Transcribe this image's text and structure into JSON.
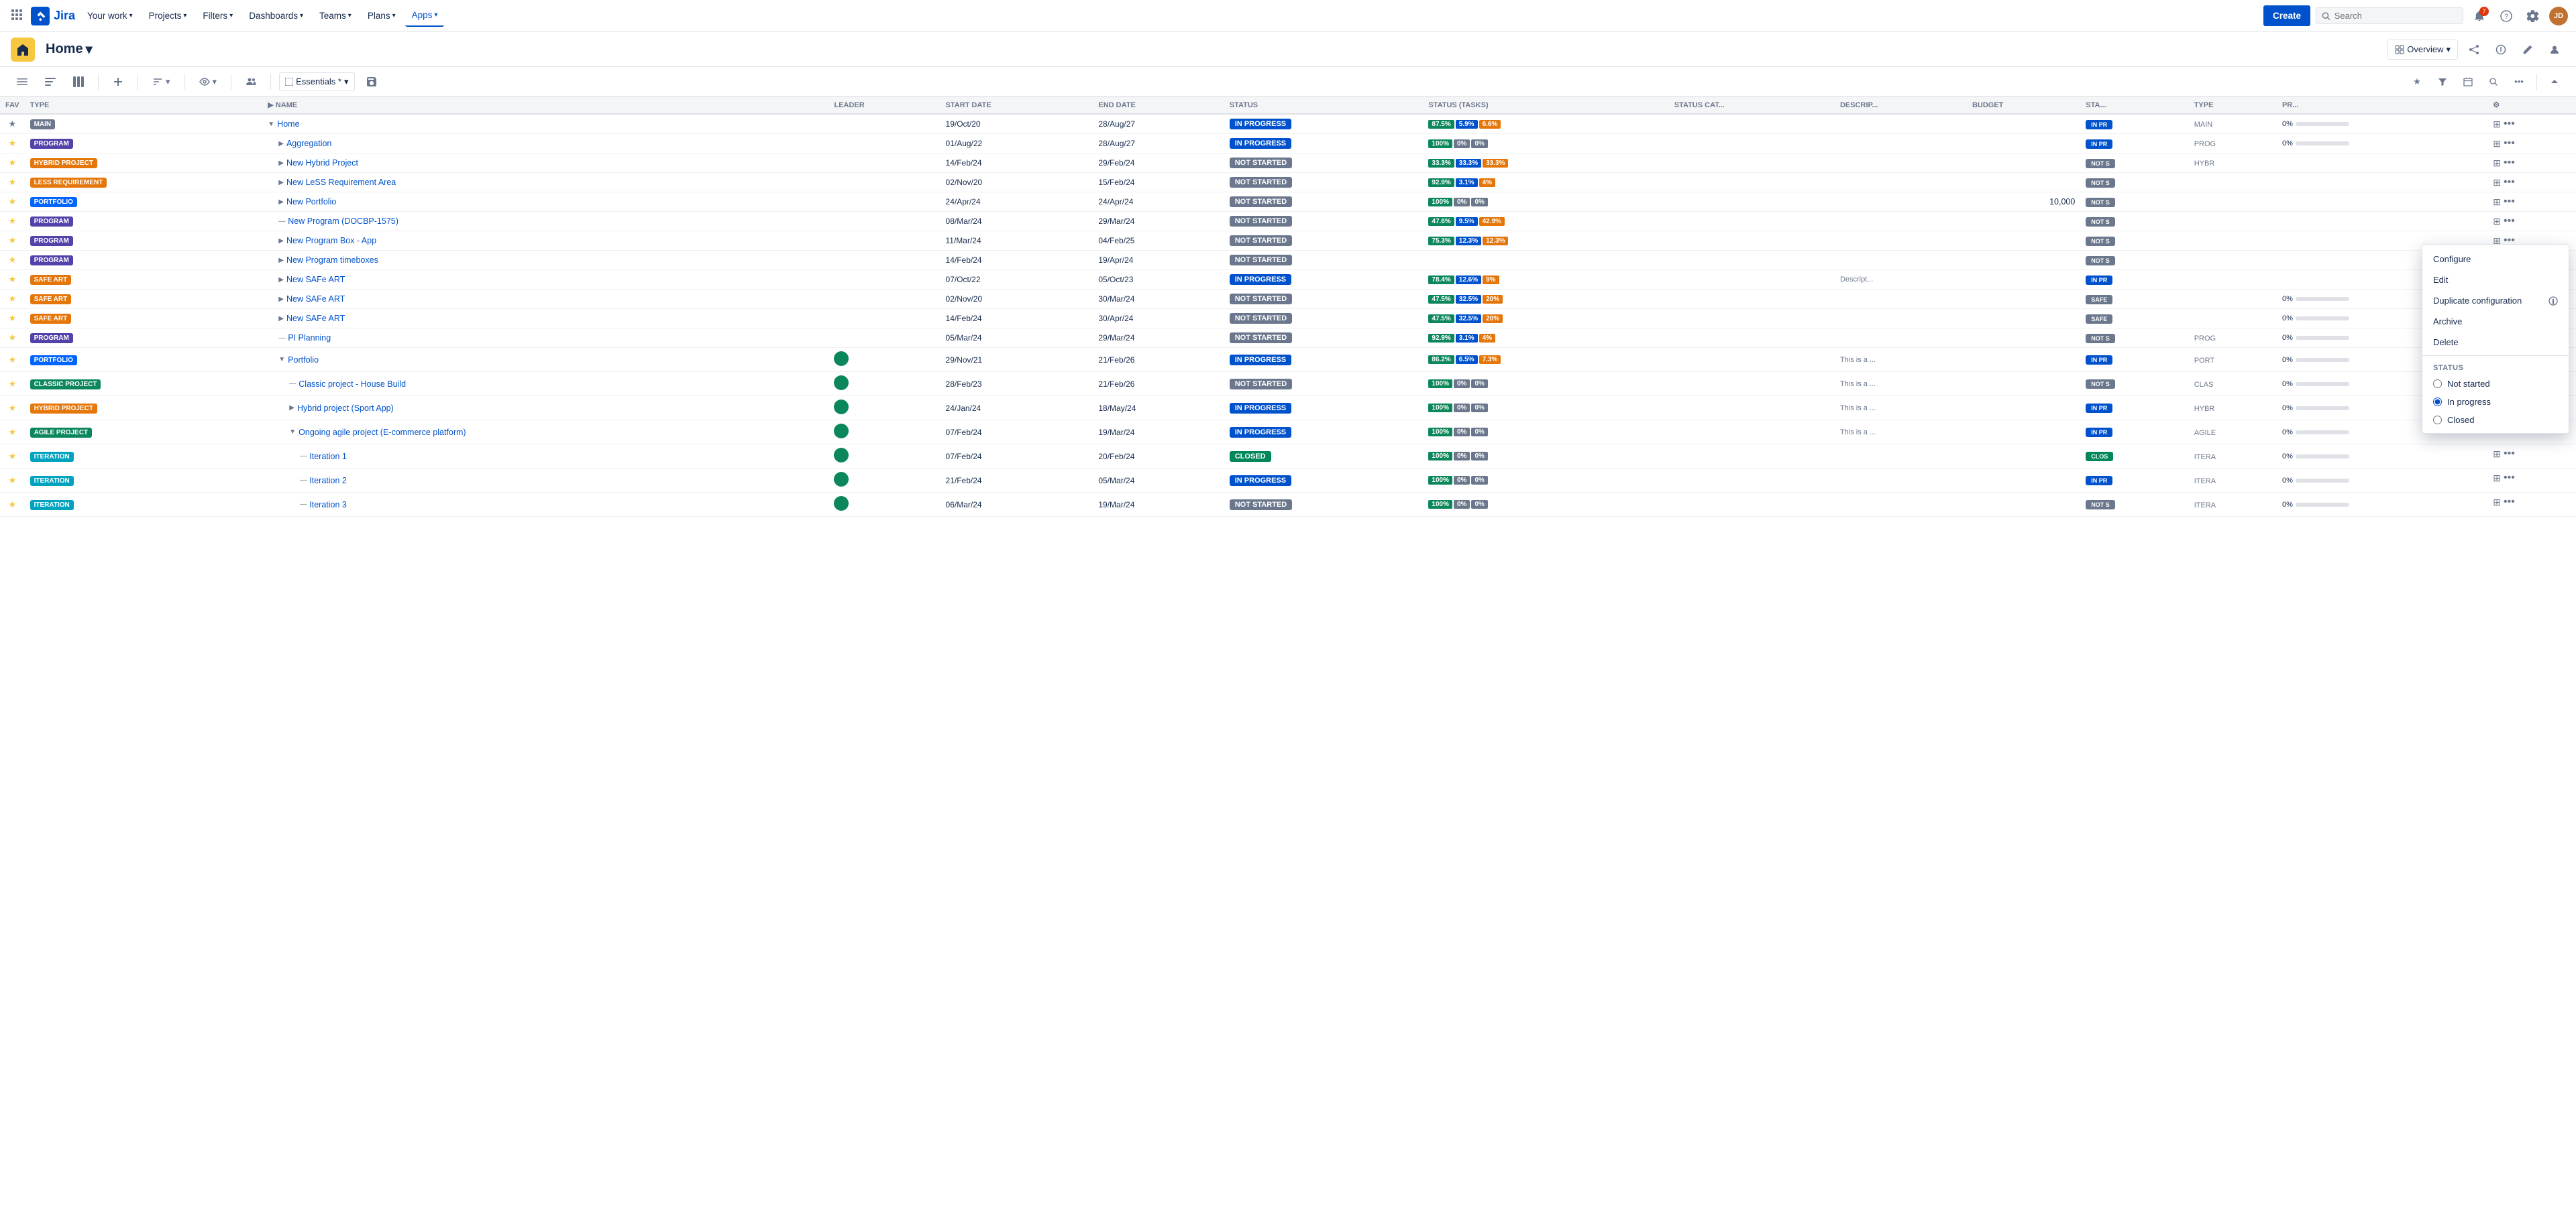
{
  "nav": {
    "logo_text": "Jira",
    "links": [
      {
        "label": "Your work",
        "caret": true
      },
      {
        "label": "Projects",
        "caret": true
      },
      {
        "label": "Filters",
        "caret": true
      },
      {
        "label": "Dashboards",
        "caret": true
      },
      {
        "label": "Teams",
        "caret": true
      },
      {
        "label": "Plans",
        "caret": true
      },
      {
        "label": "Apps",
        "caret": true,
        "active": true
      }
    ],
    "create_label": "Create",
    "search_placeholder": "Search",
    "notification_count": "7"
  },
  "second_nav": {
    "title": "Home",
    "overview_label": "Overview"
  },
  "toolbar": {
    "essentials_label": "Essentials *"
  },
  "table": {
    "headers": [
      "FAV",
      "TYPE",
      "NAME",
      "LEADER",
      "START DATE",
      "END DATE",
      "STATUS",
      "STATUS (TASKS)",
      "STATUS CAT...",
      "DESCRIP...",
      "BUDGET",
      "STA...",
      "TYPE",
      "PR..."
    ],
    "rows": [
      {
        "fav": false,
        "type": "MAIN",
        "type_class": "type-main",
        "name": "Home",
        "indent": 0,
        "expand": "collapse",
        "leader": "",
        "start": "19/Oct/20",
        "end": "28/Aug/27",
        "status": "IN PROGRESS",
        "status_class": "status-in-progress",
        "prog1": "87.5%",
        "prog1_class": "prog-green",
        "prog2": "5.9%",
        "prog2_class": "prog-blue",
        "prog3": "6.6%",
        "prog3_class": "prog-orange",
        "desc": "",
        "budget": "",
        "sta": "IN PR",
        "type2": "MAIN",
        "pr": "0%"
      },
      {
        "fav": true,
        "type": "PROGRAM",
        "type_class": "type-program",
        "name": "Aggregation",
        "indent": 1,
        "expand": "expand",
        "leader": "",
        "start": "01/Aug/22",
        "end": "28/Aug/27",
        "status": "IN PROGRESS",
        "status_class": "status-in-progress",
        "prog1": "100%",
        "prog1_class": "prog-green",
        "prog2": "0%",
        "prog2_class": "prog-gray",
        "prog3": "0%",
        "prog3_class": "prog-gray",
        "desc": "",
        "budget": "",
        "sta": "IN PR",
        "type2": "PROG",
        "pr": "0%"
      },
      {
        "fav": true,
        "type": "HYBRID PROJECT",
        "type_class": "type-hybrid",
        "name": "New Hybrid Project",
        "indent": 1,
        "expand": "expand",
        "leader": "",
        "start": "14/Feb/24",
        "end": "29/Feb/24",
        "status": "NOT STARTED",
        "status_class": "status-not-started",
        "prog1": "33.3%",
        "prog1_class": "prog-green",
        "prog2": "33.3%",
        "prog2_class": "prog-blue",
        "prog3": "33.3%",
        "prog3_class": "prog-orange",
        "desc": "",
        "budget": "",
        "sta": "NOT S",
        "type2": "HYBR",
        "pr": ""
      },
      {
        "fav": true,
        "type": "LESS REQUIREMENT",
        "type_class": "type-less",
        "name": "New LeSS Requirement Area",
        "indent": 1,
        "expand": "expand",
        "leader": "",
        "start": "02/Nov/20",
        "end": "15/Feb/24",
        "status": "NOT STARTED",
        "status_class": "status-not-started",
        "prog1": "92.9%",
        "prog1_class": "prog-green",
        "prog2": "3.1%",
        "prog2_class": "prog-blue",
        "prog3": "4%",
        "prog3_class": "prog-orange",
        "desc": "",
        "budget": "",
        "sta": "NOT S",
        "type2": "",
        "pr": ""
      },
      {
        "fav": true,
        "type": "PORTFOLIO",
        "type_class": "type-portfolio",
        "name": "New Portfolio",
        "indent": 1,
        "expand": "expand",
        "leader": "",
        "start": "24/Apr/24",
        "end": "24/Apr/24",
        "status": "NOT STARTED",
        "status_class": "status-not-started",
        "prog1": "100%",
        "prog1_class": "prog-green",
        "prog2": "0%",
        "prog2_class": "prog-gray",
        "prog3": "0%",
        "prog3_class": "prog-gray",
        "desc": "",
        "budget": "10,000",
        "sta": "NOT S",
        "type2": "",
        "pr": ""
      },
      {
        "fav": true,
        "type": "PROGRAM",
        "type_class": "type-program",
        "name": "New Program (DOCBP-1575)",
        "indent": 1,
        "expand": "dash",
        "leader": "",
        "start": "08/Mar/24",
        "end": "29/Mar/24",
        "status": "NOT STARTED",
        "status_class": "status-not-started",
        "prog1": "47.6%",
        "prog1_class": "prog-green",
        "prog2": "9.5%",
        "prog2_class": "prog-blue",
        "prog3": "42.9%",
        "prog3_class": "prog-orange",
        "desc": "",
        "budget": "",
        "sta": "NOT S",
        "type2": "",
        "pr": ""
      },
      {
        "fav": true,
        "type": "PROGRAM",
        "type_class": "type-program",
        "name": "New Program Box - App",
        "indent": 1,
        "expand": "expand",
        "leader": "",
        "start": "11/Mar/24",
        "end": "04/Feb/25",
        "status": "NOT STARTED",
        "status_class": "status-not-started",
        "prog1": "75.3%",
        "prog1_class": "prog-green",
        "prog2": "12.3%",
        "prog2_class": "prog-blue",
        "prog3": "12.3%",
        "prog3_class": "prog-orange",
        "desc": "",
        "budget": "",
        "sta": "NOT S",
        "type2": "",
        "pr": ""
      },
      {
        "fav": true,
        "type": "PROGRAM",
        "type_class": "type-program",
        "name": "New Program timeboxes",
        "indent": 1,
        "expand": "expand",
        "leader": "",
        "start": "14/Feb/24",
        "end": "19/Apr/24",
        "status": "NOT STARTED",
        "status_class": "status-not-started",
        "prog1": "",
        "prog1_class": "",
        "prog2": "",
        "prog2_class": "",
        "prog3": "",
        "prog3_class": "",
        "desc": "",
        "budget": "",
        "sta": "NOT S",
        "type2": "",
        "pr": ""
      },
      {
        "fav": true,
        "type": "SAFE ART",
        "type_class": "type-safe",
        "name": "New SAFe ART",
        "indent": 1,
        "expand": "expand",
        "leader": "",
        "start": "07/Oct/22",
        "end": "05/Oct/23",
        "status": "IN PROGRESS",
        "status_class": "status-in-progress",
        "prog1": "78.4%",
        "prog1_class": "prog-green",
        "prog2": "12.6%",
        "prog2_class": "prog-blue",
        "prog3": "9%",
        "prog3_class": "prog-orange",
        "desc": "Descript...",
        "budget": "",
        "sta": "IN PR",
        "type2": "",
        "pr": ""
      },
      {
        "fav": true,
        "type": "SAFE ART",
        "type_class": "type-safe",
        "name": "New SAFe ART",
        "indent": 1,
        "expand": "expand",
        "leader": "",
        "start": "02/Nov/20",
        "end": "30/Mar/24",
        "status": "NOT STARTED",
        "status_class": "status-not-started",
        "prog1": "47.5%",
        "prog1_class": "prog-green",
        "prog2": "32.5%",
        "prog2_class": "prog-blue",
        "prog3": "20%",
        "prog3_class": "prog-orange",
        "desc": "",
        "budget": "",
        "sta": "SAFE",
        "type2": "",
        "pr": "0%"
      },
      {
        "fav": true,
        "type": "SAFE ART",
        "type_class": "type-safe",
        "name": "New SAFe ART",
        "indent": 1,
        "expand": "expand",
        "leader": "",
        "start": "14/Feb/24",
        "end": "30/Apr/24",
        "status": "NOT STARTED",
        "status_class": "status-not-started",
        "prog1": "47.5%",
        "prog1_class": "prog-green",
        "prog2": "32.5%",
        "prog2_class": "prog-blue",
        "prog3": "20%",
        "prog3_class": "prog-orange",
        "desc": "",
        "budget": "",
        "sta": "SAFE",
        "type2": "",
        "pr": "0%"
      },
      {
        "fav": true,
        "type": "PROGRAM",
        "type_class": "type-program",
        "name": "PI Planning",
        "indent": 1,
        "expand": "dash",
        "leader": "",
        "start": "05/Mar/24",
        "end": "29/Mar/24",
        "status": "NOT STARTED",
        "status_class": "status-not-started",
        "prog1": "92.9%",
        "prog1_class": "prog-green",
        "prog2": "3.1%",
        "prog2_class": "prog-blue",
        "prog3": "4%",
        "prog3_class": "prog-orange",
        "desc": "",
        "budget": "",
        "sta": "NOT S",
        "type2": "PROG",
        "pr": "0%"
      },
      {
        "fav": true,
        "type": "PORTFOLIO",
        "type_class": "type-portfolio",
        "name": "Portfolio",
        "indent": 1,
        "expand": "collapse",
        "leader": "avatar",
        "start": "29/Nov/21",
        "end": "21/Feb/26",
        "status": "IN PROGRESS",
        "status_class": "status-in-progress",
        "prog1": "86.2%",
        "prog1_class": "prog-green",
        "prog2": "6.5%",
        "prog2_class": "prog-blue",
        "prog3": "7.3%",
        "prog3_class": "prog-orange",
        "desc": "This is a ...",
        "budget": "",
        "sta": "IN PR",
        "type2": "PORT",
        "pr": "0%"
      },
      {
        "fav": true,
        "type": "CLASSIC PROJECT",
        "type_class": "type-classic",
        "name": "Classic project - House Build",
        "indent": 2,
        "expand": "dash",
        "leader": "avatar",
        "start": "28/Feb/23",
        "end": "21/Feb/26",
        "status": "NOT STARTED",
        "status_class": "status-not-started",
        "prog1": "100%",
        "prog1_class": "prog-green",
        "prog2": "0%",
        "prog2_class": "prog-gray",
        "prog3": "0%",
        "prog3_class": "prog-gray",
        "desc": "This is a ...",
        "budget": "",
        "sta": "NOT S",
        "type2": "CLAS",
        "pr": "0%"
      },
      {
        "fav": true,
        "type": "HYBRID PROJECT",
        "type_class": "type-hybrid",
        "name": "Hybrid project (Sport App)",
        "indent": 2,
        "expand": "expand",
        "leader": "avatar",
        "start": "24/Jan/24",
        "end": "18/May/24",
        "status": "IN PROGRESS",
        "status_class": "status-in-progress",
        "prog1": "100%",
        "prog1_class": "prog-green",
        "prog2": "0%",
        "prog2_class": "prog-gray",
        "prog3": "0%",
        "prog3_class": "prog-gray",
        "desc": "This is a ...",
        "budget": "",
        "sta": "IN PR",
        "type2": "HYBR",
        "pr": "0%"
      },
      {
        "fav": true,
        "type": "AGILE PROJECT",
        "type_class": "type-agile",
        "name": "Ongoing agile project (E-commerce platform)",
        "indent": 2,
        "expand": "collapse",
        "leader": "avatar",
        "start": "07/Feb/24",
        "end": "19/Mar/24",
        "status": "IN PROGRESS",
        "status_class": "status-in-progress",
        "prog1": "100%",
        "prog1_class": "prog-green",
        "prog2": "0%",
        "prog2_class": "prog-gray",
        "prog3": "0%",
        "prog3_class": "prog-gray",
        "desc": "This is a ...",
        "budget": "",
        "sta": "IN PR",
        "type2": "AGILE",
        "pr": "0%"
      },
      {
        "fav": true,
        "type": "ITERATION",
        "type_class": "type-iteration",
        "name": "Iteration 1",
        "indent": 3,
        "expand": "dash",
        "leader": "avatar",
        "start": "07/Feb/24",
        "end": "20/Feb/24",
        "status": "CLOSED",
        "status_class": "status-closed",
        "prog1": "100%",
        "prog1_class": "prog-green",
        "prog2": "0%",
        "prog2_class": "prog-gray",
        "prog3": "0%",
        "prog3_class": "prog-gray",
        "desc": "",
        "budget": "",
        "sta": "CLOS",
        "type2": "ITERA",
        "pr": "0%"
      },
      {
        "fav": true,
        "type": "ITERATION",
        "type_class": "type-iteration",
        "name": "Iteration 2",
        "indent": 3,
        "expand": "dash",
        "leader": "avatar",
        "start": "21/Feb/24",
        "end": "05/Mar/24",
        "status": "IN PROGRESS",
        "status_class": "status-in-progress",
        "prog1": "100%",
        "prog1_class": "prog-green",
        "prog2": "0%",
        "prog2_class": "prog-gray",
        "prog3": "0%",
        "prog3_class": "prog-gray",
        "desc": "",
        "budget": "",
        "sta": "IN PR",
        "type2": "ITERA",
        "pr": "0%"
      },
      {
        "fav": true,
        "type": "ITERATION",
        "type_class": "type-iteration",
        "name": "Iteration 3",
        "indent": 3,
        "expand": "dash",
        "leader": "avatar",
        "start": "06/Mar/24",
        "end": "19/Mar/24",
        "status": "NOT STARTED",
        "status_class": "status-not-started",
        "prog1": "100%",
        "prog1_class": "prog-green",
        "prog2": "0%",
        "prog2_class": "prog-gray",
        "prog3": "0%",
        "prog3_class": "prog-gray",
        "desc": "",
        "budget": "",
        "sta": "NOT S",
        "type2": "ITERA",
        "pr": "0%"
      }
    ]
  },
  "context_menu": {
    "items": [
      {
        "label": "Configure",
        "type": "action"
      },
      {
        "label": "Edit",
        "type": "action"
      },
      {
        "label": "Duplicate configuration",
        "type": "action"
      },
      {
        "label": "Archive",
        "type": "action"
      },
      {
        "label": "Delete",
        "type": "action"
      }
    ],
    "status_section": "STATUS",
    "status_options": [
      {
        "label": "Not started",
        "value": "not-started",
        "checked": false
      },
      {
        "label": "In progress",
        "value": "in-progress",
        "checked": true
      },
      {
        "label": "Closed",
        "value": "closed",
        "checked": false
      }
    ]
  }
}
